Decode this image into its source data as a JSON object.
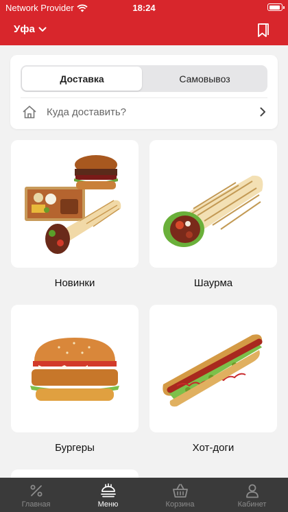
{
  "status_bar": {
    "carrier": "Network Provider",
    "time": "18:24"
  },
  "header": {
    "city": "Уфа"
  },
  "delivery": {
    "tabs": [
      "Доставка",
      "Самовывоз"
    ],
    "active_tab": "Доставка",
    "address_placeholder": "Куда доставить?"
  },
  "categories": [
    {
      "label": "Новинки"
    },
    {
      "label": "Шаурма"
    },
    {
      "label": "Бургеры"
    },
    {
      "label": "Хот-доги"
    }
  ],
  "tab_bar": {
    "items": [
      {
        "label": "Главная",
        "icon": "percent-icon"
      },
      {
        "label": "Меню",
        "icon": "menu-food-icon"
      },
      {
        "label": "Корзина",
        "icon": "basket-icon"
      },
      {
        "label": "Кабинет",
        "icon": "user-icon"
      }
    ],
    "active": "Меню"
  },
  "colors": {
    "brand_red": "#d8262c",
    "tab_bar_bg": "#3a3a3a"
  }
}
